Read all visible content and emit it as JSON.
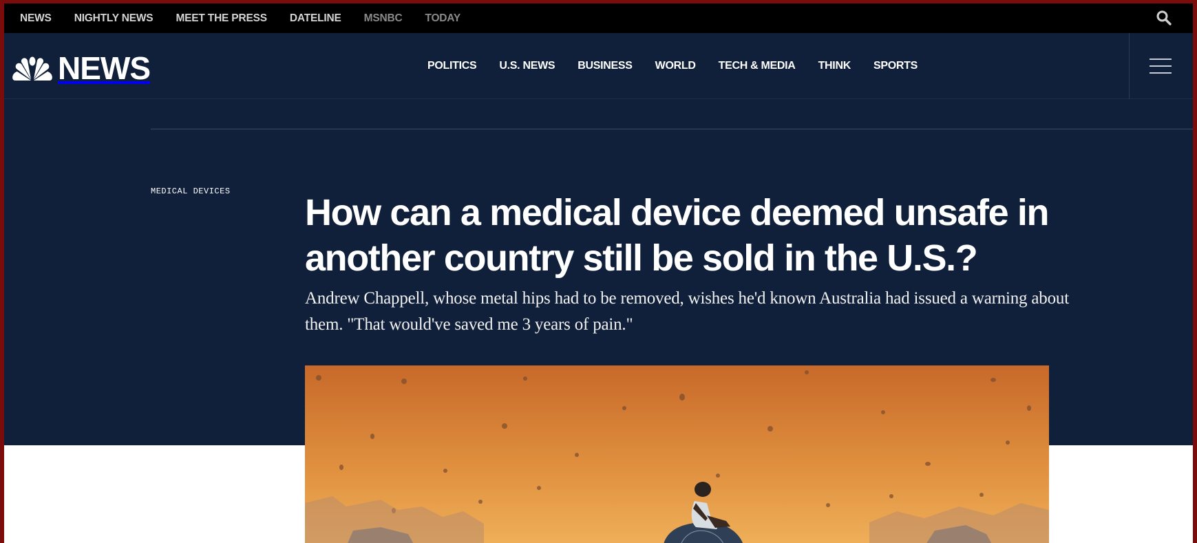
{
  "topbar": {
    "links": [
      "NEWS",
      "NIGHTLY NEWS",
      "MEET THE PRESS",
      "DATELINE",
      "MSNBC",
      "TODAY"
    ],
    "search_icon": "search-icon"
  },
  "nav": {
    "logo_text": "NEWS",
    "links": [
      "POLITICS",
      "U.S. NEWS",
      "BUSINESS",
      "WORLD",
      "TECH & MEDIA",
      "THINK",
      "SPORTS"
    ],
    "menu_icon": "hamburger-icon"
  },
  "article": {
    "eyebrow": "MEDICAL DEVICES",
    "headline": "How can a medical device deemed unsafe in another country still be sold in the U.S.?",
    "dek": "Andrew Chappell, whose metal hips had to be removed, wishes he'd known Australia had issued a warning about them. \"That would've saved me 3 years of pain.\""
  },
  "colors": {
    "navy": "#11203a",
    "topbar": "#000000",
    "art_orange": "#d07a2c"
  }
}
